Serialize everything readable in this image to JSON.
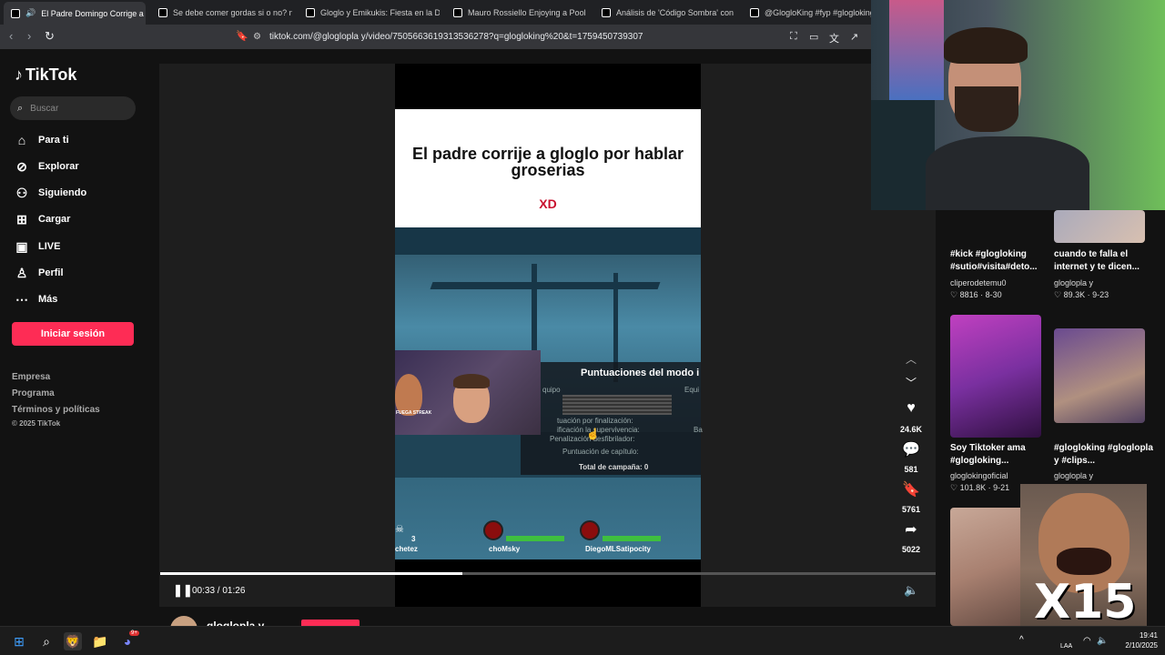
{
  "browser": {
    "tabs": [
      {
        "label": "El Padre Domingo Corrige a G",
        "active": true
      },
      {
        "label": "Se debe comer gordas si o no? no li",
        "active": false
      },
      {
        "label": "Gloglo y Emikukis: Fiesta en la Disco",
        "active": false
      },
      {
        "label": "Mauro Rossiello Enjoying a Pool Day",
        "active": false
      },
      {
        "label": "Análisis de 'Código Sombra' con Sac",
        "active": false
      },
      {
        "label": "@GlogloKing #fyp #glogloking #e",
        "active": false
      }
    ],
    "url": "tiktok.com/@gloglopla y/video/7505663619313536278?q=glogloking%20&t=1759450739307"
  },
  "sidebar": {
    "logo": "TikTok",
    "search_placeholder": "Buscar",
    "items": [
      {
        "label": "Para ti",
        "icon": "home-icon"
      },
      {
        "label": "Explorar",
        "icon": "compass-icon"
      },
      {
        "label": "Siguiendo",
        "icon": "following-icon"
      },
      {
        "label": "Cargar",
        "icon": "upload-icon"
      },
      {
        "label": "LIVE",
        "icon": "live-icon"
      },
      {
        "label": "Perfil",
        "icon": "profile-icon"
      },
      {
        "label": "Más",
        "icon": "more-icon"
      }
    ],
    "login_label": "Iniciar sesión",
    "footer": [
      "Empresa",
      "Programa",
      "Términos y políticas",
      "© 2025 TikTok"
    ]
  },
  "video": {
    "caption_title": "El padre corrije a gloglo por hablar groserias",
    "caption_sub": "XD",
    "scoreboard_title": "Puntuaciones del modo i",
    "scoreboard_rows": [
      "quipo",
      "Equi",
      "tuación por finalización:",
      "ificación la supervivencia:",
      "Penalización desfibrilador:",
      "Puntuación de capítulo:",
      "Total de campaña: 0",
      "Ba"
    ],
    "cam_badge": "FUEGA STREAK",
    "hud": [
      "3",
      "chetez",
      "choMsky",
      "DiegoMLSatipocity"
    ],
    "progress": 0.39,
    "time": "00:33 / 01:26"
  },
  "actions": {
    "likes": "24.6K",
    "comments": "581",
    "saves": "5761",
    "shares": "5022"
  },
  "recommendations": [
    {
      "title": "#kick #glogloking #sutio#visita#deto...",
      "author": "cliperodetemu0",
      "likes": "8816",
      "date": "8-30"
    },
    {
      "title": "cuando te falla el internet y te dicen...",
      "author": "gloglopla y",
      "likes": "89.3K",
      "date": "9-23"
    },
    {
      "title": "Soy Tiktoker ama #glogloking...",
      "author": "gloglokingoficial",
      "likes": "101.8K",
      "date": "9-21"
    },
    {
      "title": "#glogloking #gloglopla y #clips...",
      "author": "gloglopla y",
      "likes": "",
      "date": ""
    }
  ],
  "below_author": "gloglopla y",
  "meme_text": "X15",
  "taskbar": {
    "time": "19:41",
    "date": "2/10/2025",
    "lang": "LAA",
    "discord_badge": "9+"
  },
  "colors": {
    "accent": "#fe2c55",
    "xd": "#c8102e"
  }
}
